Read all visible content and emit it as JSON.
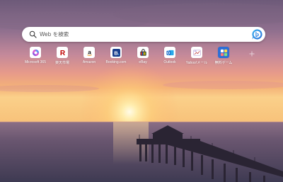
{
  "search": {
    "placeholder": "Web を検索"
  },
  "tiles": [
    {
      "label": "Microsoft 365",
      "icon": "microsoft365-icon"
    },
    {
      "label": "楽天市場",
      "icon": "rakuten-icon"
    },
    {
      "label": "Amazon",
      "icon": "amazon-icon"
    },
    {
      "label": "Booking.com",
      "icon": "booking-icon"
    },
    {
      "label": "eBay",
      "icon": "ebay-icon"
    },
    {
      "label": "Outlook",
      "icon": "outlook-icon"
    },
    {
      "label": "Yahoo!メール",
      "icon": "yahoo-mail-icon"
    },
    {
      "label": "無料ゲーム",
      "icon": "games-icon"
    }
  ],
  "add_tile": {
    "icon": "plus-icon"
  },
  "background": {
    "scene": "sunset-over-ocean-with-pier"
  }
}
